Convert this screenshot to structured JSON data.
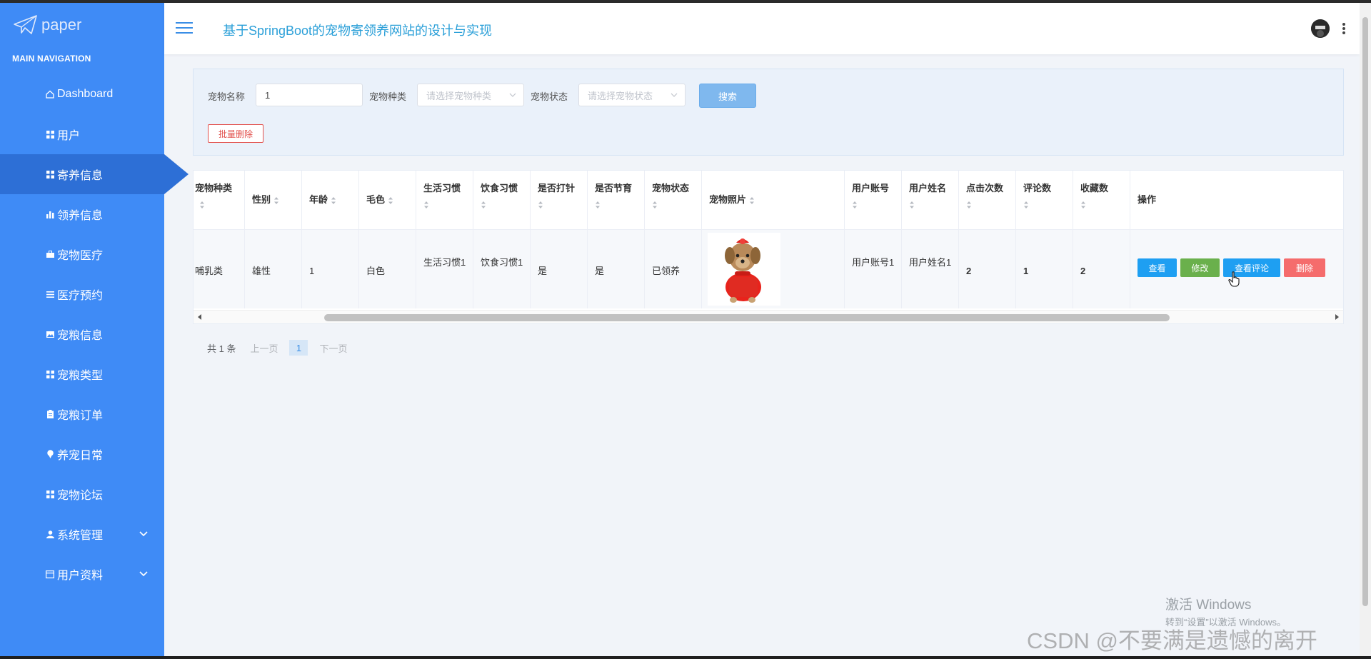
{
  "app": {
    "logo_text": "paper",
    "title": "基于SpringBoot的宠物寄领养网站的设计与实现"
  },
  "sidebar": {
    "section_label": "MAIN NAVIGATION",
    "items": [
      {
        "label": "Dashboard",
        "icon": "home-icon"
      },
      {
        "label": "用户",
        "icon": "grid-icon"
      },
      {
        "label": "寄养信息",
        "icon": "grid-icon",
        "active": true
      },
      {
        "label": "领养信息",
        "icon": "bar-chart-icon"
      },
      {
        "label": "宠物医疗",
        "icon": "briefcase-icon"
      },
      {
        "label": "医疗预约",
        "icon": "list-icon"
      },
      {
        "label": "宠粮信息",
        "icon": "image-icon"
      },
      {
        "label": "宠粮类型",
        "icon": "grid-icon"
      },
      {
        "label": "宠粮订单",
        "icon": "clipboard-icon"
      },
      {
        "label": "养宠日常",
        "icon": "pin-icon"
      },
      {
        "label": "宠物论坛",
        "icon": "grid-icon"
      },
      {
        "label": "系统管理",
        "icon": "user-icon",
        "expandable": true
      },
      {
        "label": "用户资料",
        "icon": "card-icon",
        "expandable": true
      }
    ]
  },
  "search": {
    "name_label": "宠物名称",
    "name_value": "1",
    "type_label": "宠物种类",
    "type_placeholder": "请选择宠物种类",
    "status_label": "宠物状态",
    "status_placeholder": "请选择宠物状态",
    "search_button": "搜索",
    "batch_delete_button": "批量删除"
  },
  "table": {
    "columns": [
      "宠物种类",
      "性别",
      "年龄",
      "毛色",
      "生活习惯",
      "饮食习惯",
      "是否打针",
      "是否节育",
      "宠物状态",
      "宠物照片",
      "用户账号",
      "用户姓名",
      "点击次数",
      "评论数",
      "收藏数",
      "操作"
    ],
    "rows": [
      {
        "pet_type": "哺乳类",
        "gender": "雄性",
        "age": "1",
        "fur_color": "白色",
        "living_habit": "生活习惯1",
        "eating_habit": "饮食习惯1",
        "vaccinated": "是",
        "sterilized": "是",
        "status": "已领养",
        "user_account": "用户账号1",
        "user_name": "用户姓名1",
        "clicks": "2",
        "comments": "1",
        "favorites": "2"
      }
    ],
    "actions": {
      "view": "查看",
      "edit": "修改",
      "view_comments": "查看评论",
      "delete": "删除"
    }
  },
  "pagination": {
    "total": "共 1 条",
    "prev": "上一页",
    "current": "1",
    "next": "下一页"
  },
  "watermarks": {
    "windows_line1": "激活 Windows",
    "windows_line2": "转到“设置”以激活 Windows。",
    "csdn": "CSDN @不要满是遗憾的离开"
  },
  "colors": {
    "sidebar": "#3f8bf6",
    "sidebar_active": "#2d6fd6",
    "title": "#2a9fd8",
    "view_btn": "#1e9ff2",
    "edit_btn": "#6ab04c",
    "comments_btn": "#1e9ff2",
    "delete_btn": "#f56c6c"
  }
}
